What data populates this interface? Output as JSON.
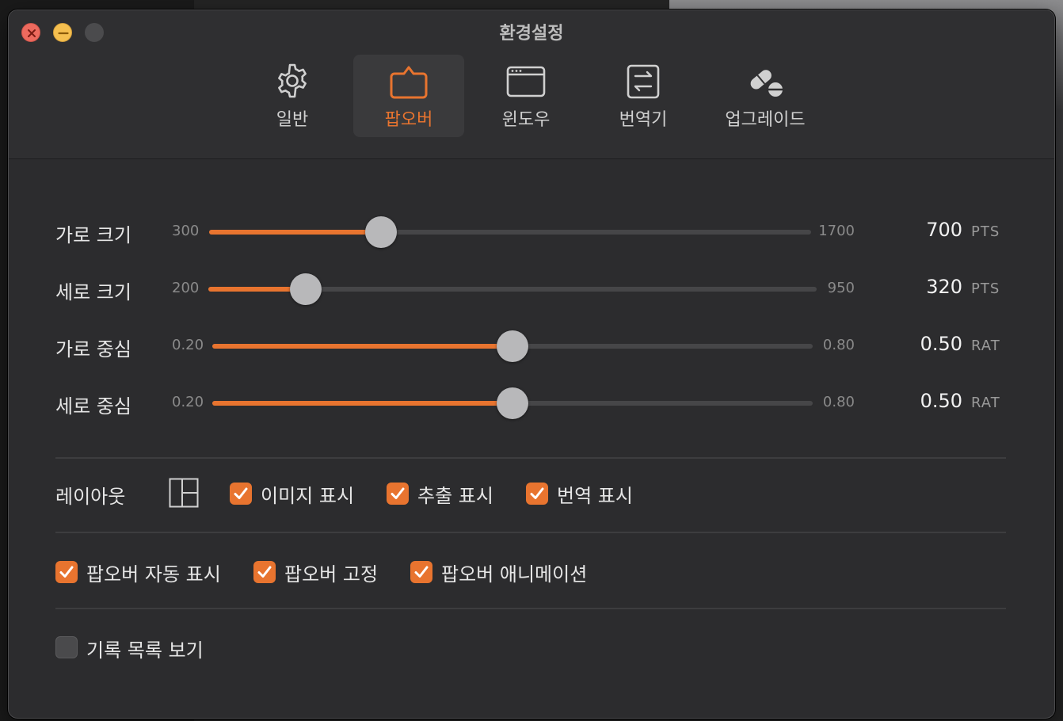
{
  "window": {
    "title": "환경설정"
  },
  "tabs": [
    {
      "label": "일반",
      "icon": "gear-icon",
      "active": false
    },
    {
      "label": "팝오버",
      "icon": "popover-icon",
      "active": true
    },
    {
      "label": "윈도우",
      "icon": "window-icon",
      "active": false
    },
    {
      "label": "번역기",
      "icon": "translate-icon",
      "active": false
    },
    {
      "label": "업그레이드",
      "icon": "pills-icon",
      "active": false
    }
  ],
  "sliders": [
    {
      "label": "가로 크기",
      "min": "300",
      "max": "1700",
      "value": 700,
      "value_text": "700",
      "unit": "PTS",
      "range": [
        300,
        1700
      ]
    },
    {
      "label": "세로 크기",
      "min": "200",
      "max": "950",
      "value": 320,
      "value_text": "320",
      "unit": "PTS",
      "range": [
        200,
        950
      ]
    },
    {
      "label": "가로 중심",
      "min": "0.20",
      "max": "0.80",
      "value": 0.5,
      "value_text": "0.50",
      "unit": "RAT",
      "range": [
        0.2,
        0.8
      ]
    },
    {
      "label": "세로 중심",
      "min": "0.20",
      "max": "0.80",
      "value": 0.5,
      "value_text": "0.50",
      "unit": "RAT",
      "range": [
        0.2,
        0.8
      ]
    }
  ],
  "layout": {
    "label": "레이아웃",
    "options": [
      {
        "label": "이미지 표시",
        "checked": true
      },
      {
        "label": "추출 표시",
        "checked": true
      },
      {
        "label": "번역 표시",
        "checked": true
      }
    ]
  },
  "popover_options": [
    {
      "label": "팝오버 자동 표시",
      "checked": true
    },
    {
      "label": "팝오버 고정",
      "checked": true
    },
    {
      "label": "팝오버 애니메이션",
      "checked": true
    }
  ],
  "history": {
    "label": "기록 목록 보기",
    "checked": false
  },
  "colors": {
    "accent": "#e8742f",
    "window_bg": "#2c2c2e",
    "track": "#464648",
    "thumb": "#b8b8ba"
  }
}
